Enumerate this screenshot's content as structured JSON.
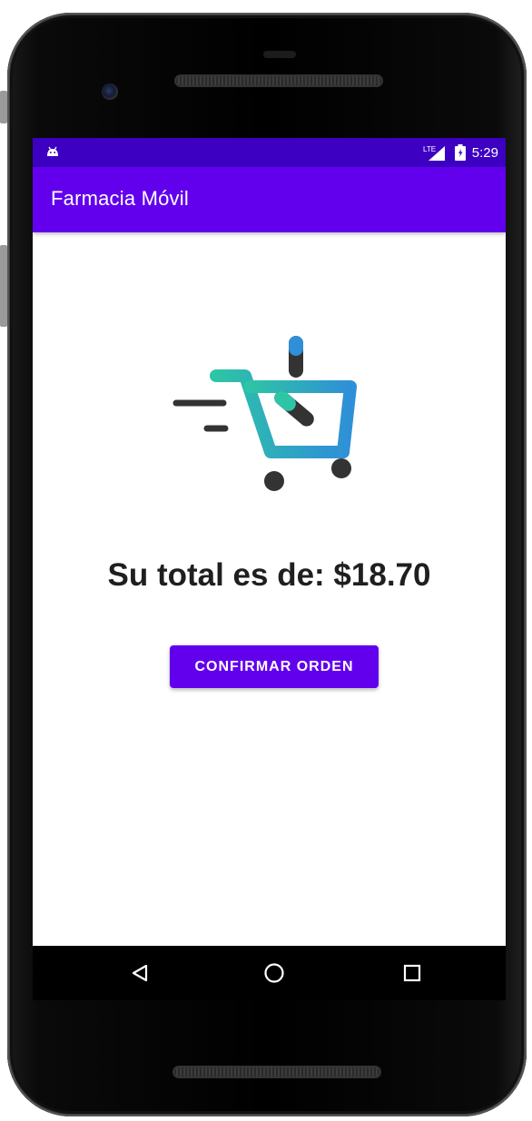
{
  "status_bar": {
    "time": "5:29",
    "network": "LTE",
    "icons": [
      "android-icon",
      "lte-signal-icon",
      "battery-icon"
    ],
    "background": "#3d00c2"
  },
  "app_bar": {
    "title": "Farmacia Móvil",
    "background": "#6200ee"
  },
  "main": {
    "logo_icon": "pharmacy-cart-icon",
    "total_text": "Su total es de: $18.70",
    "confirm_button_label": "CONFIRMAR ORDEN"
  },
  "nav_bar": {
    "icons": [
      "back-icon",
      "home-icon",
      "recents-icon"
    ]
  },
  "colors": {
    "primary": "#6200ee",
    "primary_dark": "#3d00c2",
    "logo_teal": "#2ec4a6",
    "logo_blue": "#2f8fd8",
    "logo_dark": "#333333"
  }
}
